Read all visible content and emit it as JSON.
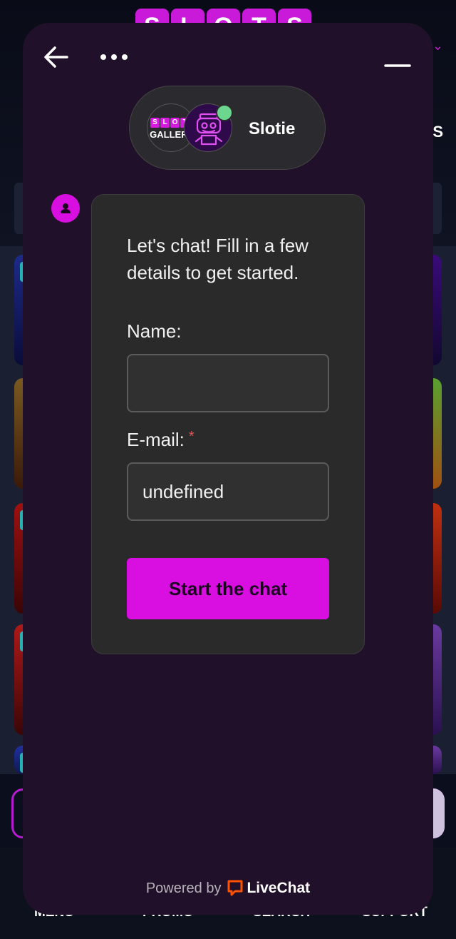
{
  "background": {
    "logo_letters": [
      "S",
      "L",
      "O",
      "T",
      "S"
    ],
    "cut_text": "AS",
    "nav": [
      "MENU",
      "PROMO",
      "SEARCH",
      "SUPPORT"
    ]
  },
  "widget": {
    "header": {
      "back_icon": "arrow-left-icon",
      "more_icon": "more-dots-icon",
      "minimize_icon": "minimize-icon"
    },
    "agent": {
      "name": "Slotie",
      "logo_top": [
        "S",
        "L",
        "O",
        "T",
        "S"
      ],
      "logo_bottom": "GALLERY",
      "status_color": "#6cd68f"
    },
    "form": {
      "intro": "Let's chat! Fill in a few details to get started.",
      "name_label": "Name:",
      "name_value": "",
      "email_label": "E-mail:",
      "email_required_mark": "*",
      "email_value": "undefined",
      "submit_label": "Start the chat"
    },
    "footer": {
      "powered_by": "Powered by",
      "brand": "LiveChat"
    }
  },
  "colors": {
    "accent": "#d80fe0",
    "widget_bg": "#211029",
    "card_bg": "#2a2a2a",
    "livechat_orange": "#ff5100"
  }
}
